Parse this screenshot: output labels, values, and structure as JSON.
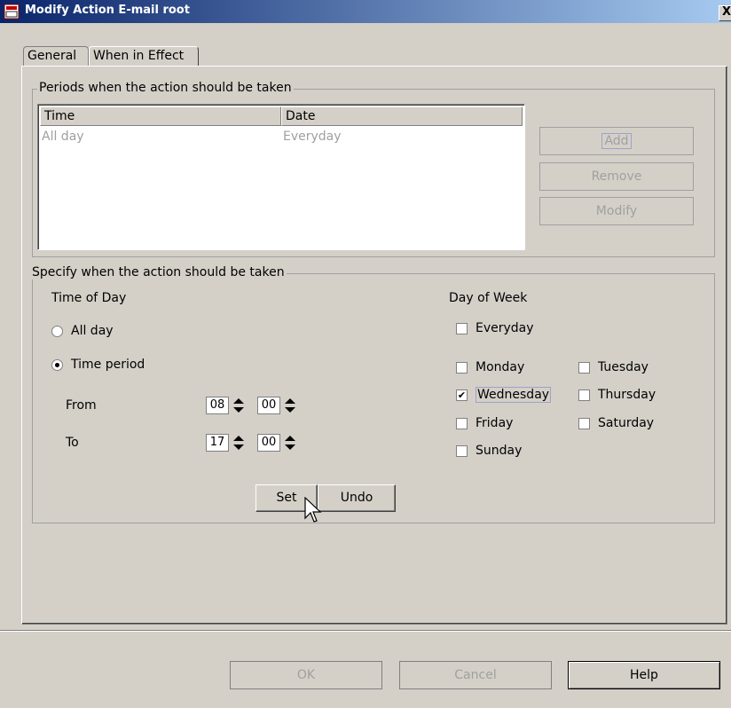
{
  "window": {
    "title": "Modify Action E-mail root",
    "close_label": "X"
  },
  "tabs": [
    {
      "label": "General",
      "active": false
    },
    {
      "label": "When in Effect",
      "active": true
    }
  ],
  "periods": {
    "legend": "Periods when the action should be taken",
    "columns": [
      "Time",
      "Date"
    ],
    "rows": [
      {
        "time": "All day",
        "date": "Everyday"
      }
    ],
    "buttons": {
      "add": "Add",
      "remove": "Remove",
      "modify": "Modify"
    }
  },
  "specify": {
    "legend": "Specify when the action should be taken",
    "time_of_day": {
      "heading": "Time of Day",
      "all_day_label": "All day",
      "all_day_selected": false,
      "time_period_label": "Time period",
      "time_period_selected": true,
      "from_label": "From",
      "from_hour": "08",
      "from_minute": "00",
      "to_label": "To",
      "to_hour": "17",
      "to_minute": "00"
    },
    "day_of_week": {
      "heading": "Day of Week",
      "everyday": {
        "label": "Everyday",
        "checked": false
      },
      "monday": {
        "label": "Monday",
        "checked": false
      },
      "tuesday": {
        "label": "Tuesday",
        "checked": false
      },
      "wednesday": {
        "label": "Wednesday",
        "checked": true
      },
      "thursday": {
        "label": "Thursday",
        "checked": false
      },
      "friday": {
        "label": "Friday",
        "checked": false
      },
      "saturday": {
        "label": "Saturday",
        "checked": false
      },
      "sunday": {
        "label": "Sunday",
        "checked": false
      }
    },
    "set_label": "Set",
    "undo_label": "Undo"
  },
  "footer": {
    "ok_label": "OK",
    "cancel_label": "Cancel",
    "help_label": "Help"
  },
  "colors": {
    "titlebar_start": "#0a246a",
    "titlebar_end": "#a6caf0",
    "window_bg": "#d4d0c8",
    "disabled_text": "#a0a0a0"
  }
}
